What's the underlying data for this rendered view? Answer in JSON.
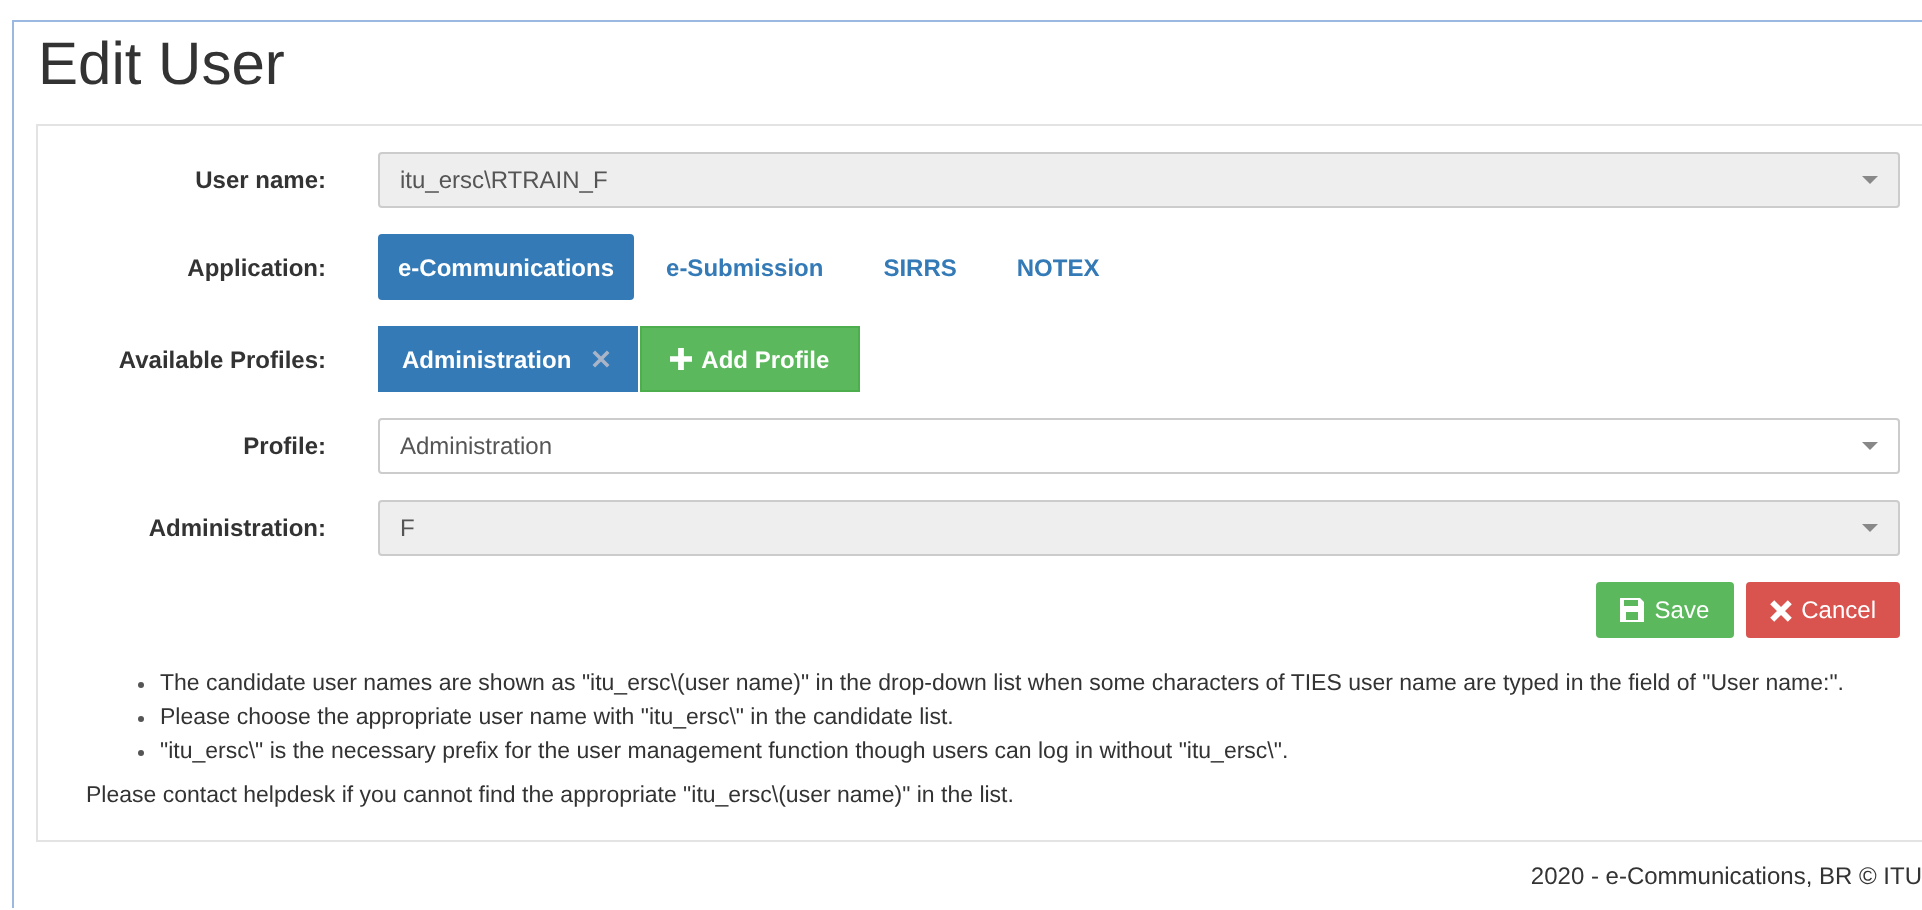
{
  "title": "Edit User",
  "rows": [
    {
      "kind": "select",
      "label": "User name:",
      "value": "itu_ersc\\RTRAIN_F",
      "disabled": true
    },
    {
      "kind": "pills",
      "label": "Application:",
      "options": [
        {
          "label": "e-Communications",
          "selected": true
        },
        {
          "label": "e-Submission",
          "selected": false
        },
        {
          "label": "SIRRS",
          "selected": false
        },
        {
          "label": "NOTEX",
          "selected": false
        }
      ]
    },
    {
      "kind": "chips",
      "label": "Available Profiles:",
      "chips": [
        "Administration"
      ],
      "add_button": "Add Profile"
    },
    {
      "kind": "select",
      "label": "Profile:",
      "value": "Administration",
      "disabled": false
    },
    {
      "kind": "select",
      "label": "Administration:",
      "value": "F",
      "disabled": true
    }
  ],
  "buttons": [
    {
      "kind": "save",
      "label": "Save"
    },
    {
      "kind": "cancel",
      "label": "Cancel"
    }
  ],
  "notes": [
    "The candidate user names are shown as \"itu_ersc\\(user name)\" in the drop-down list when some characters of TIES user name are typed in the field of \"User name:\".",
    "Please choose the appropriate user name with \"itu_ersc\\\" in the candidate list.",
    "\"itu_ersc\\\" is the necessary prefix for the user management function though users can log in without \"itu_ersc\\\"."
  ],
  "contact": "Please contact helpdesk if you cannot find the appropriate \"itu_ersc\\(user name)\" in the list.",
  "footer": "2020 - e-Communications, BR © ITU"
}
